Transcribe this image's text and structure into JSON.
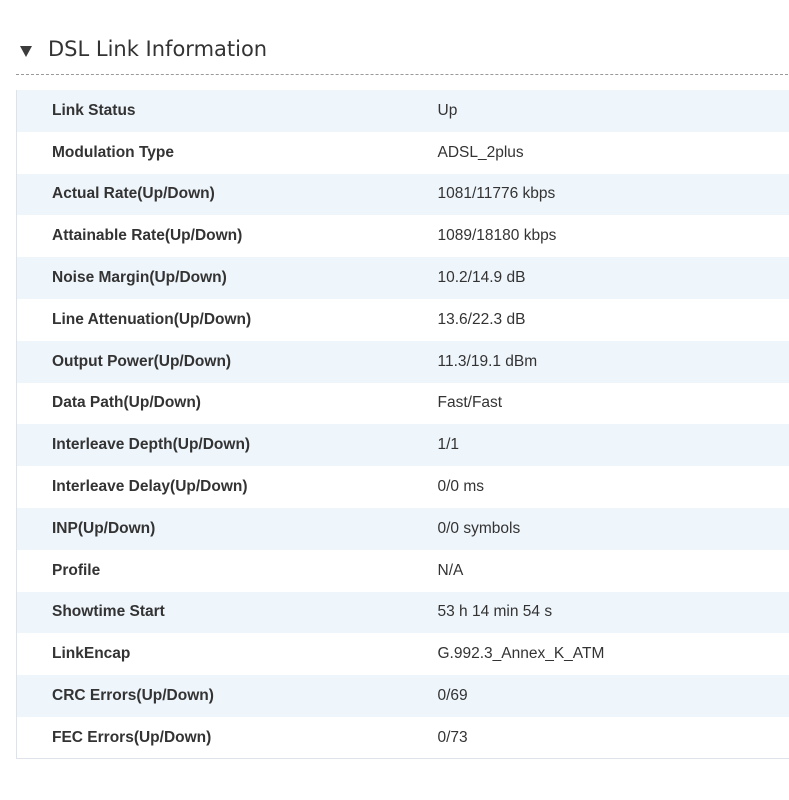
{
  "section": {
    "title": "DSL Link Information",
    "expanded": true,
    "toggle_icon": "triangle-down-icon"
  },
  "rows": [
    {
      "label": "Link Status",
      "value": "Up"
    },
    {
      "label": "Modulation Type",
      "value": "ADSL_2plus"
    },
    {
      "label": "Actual Rate(Up/Down)",
      "value": "1081/11776 kbps"
    },
    {
      "label": "Attainable Rate(Up/Down)",
      "value": "1089/18180 kbps"
    },
    {
      "label": "Noise Margin(Up/Down)",
      "value": "10.2/14.9 dB"
    },
    {
      "label": "Line Attenuation(Up/Down)",
      "value": "13.6/22.3 dB"
    },
    {
      "label": "Output Power(Up/Down)",
      "value": "11.3/19.1 dBm"
    },
    {
      "label": "Data Path(Up/Down)",
      "value": "Fast/Fast"
    },
    {
      "label": "Interleave Depth(Up/Down)",
      "value": "1/1"
    },
    {
      "label": "Interleave Delay(Up/Down)",
      "value": "0/0 ms"
    },
    {
      "label": "INP(Up/Down)",
      "value": "0/0 symbols"
    },
    {
      "label": "Profile",
      "value": "N/A"
    },
    {
      "label": "Showtime Start",
      "value": "53 h 14 min 54 s"
    },
    {
      "label": "LinkEncap",
      "value": "G.992.3_Annex_K_ATM"
    },
    {
      "label": "CRC Errors(Up/Down)",
      "value": "0/69"
    },
    {
      "label": "FEC Errors(Up/Down)",
      "value": "0/73"
    }
  ],
  "colors": {
    "row_stripe": "#eef5fb",
    "text": "#333333",
    "divider": "#9a9a9a"
  }
}
